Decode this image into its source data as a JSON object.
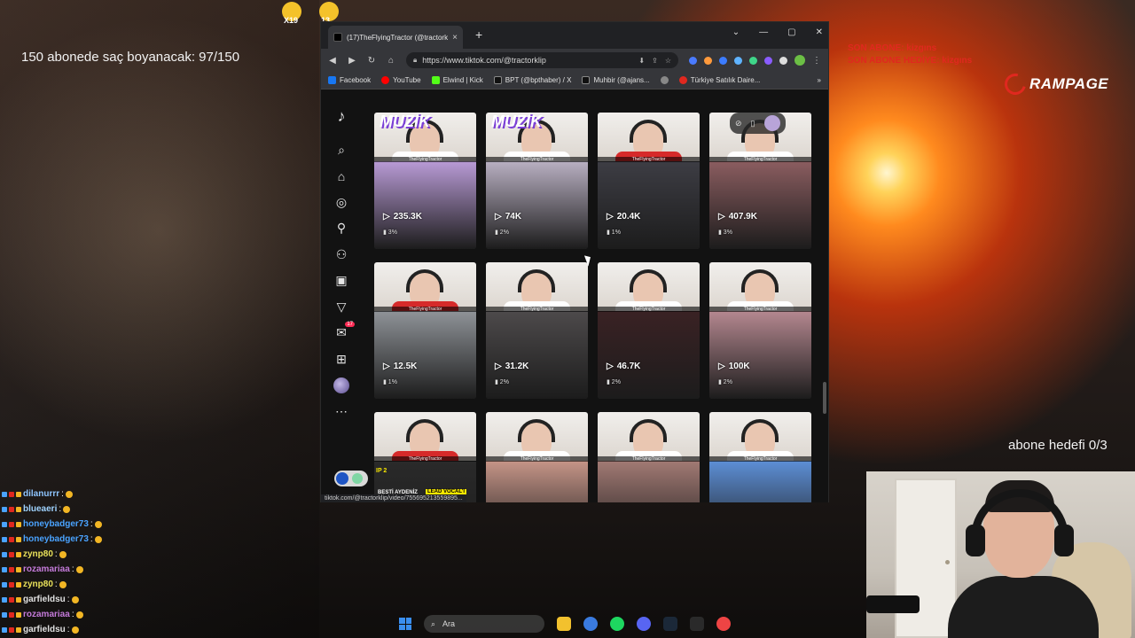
{
  "overlay": {
    "sub_goal": "150 abonede saç boyanacak: 97/150",
    "abone_hedefi": "abone hedefi 0/3",
    "son_abone": "SON ABONE: kizgıns",
    "son_abone_hediye": "SON ABONE HEDİYE: kizgıns",
    "brand": "RAMPAGE",
    "emote_1_count": "X19",
    "emote_2_count": "13"
  },
  "browser": {
    "tab_title": "(17)TheFlyingTractor (@tractorkli",
    "tab_close": "×",
    "new_tab": "+",
    "url": "https://www.tiktok.com/@tractorklip",
    "window_controls": [
      "⌄",
      "—",
      "▢",
      "✕"
    ],
    "bookmarks": [
      {
        "label": "Facebook",
        "color": "#1877f2"
      },
      {
        "label": "YouTube",
        "color": "#ff0000"
      },
      {
        "label": "Elwind | Kick",
        "color": "#53fc18"
      },
      {
        "label": "BPT (@bpthaber) / X",
        "color": "#111111"
      },
      {
        "label": "Muhbir (@ajans...",
        "color": "#111111"
      },
      {
        "label": "",
        "color": "#888888"
      },
      {
        "label": "Türkiye Satılık Daire...",
        "color": "#e0281f"
      }
    ],
    "status_url": "tiktok.com/@tractorklip/video/755695213559895..."
  },
  "tiktok": {
    "notification_count": "17",
    "sidebar_icons": [
      "tiktok-logo-icon",
      "search-icon",
      "home-icon",
      "explore-icon",
      "following-icon",
      "friends-icon",
      "live-icon",
      "upload-icon",
      "inbox-icon",
      "create-icon",
      "profile-icon",
      "more-icon"
    ],
    "videos": [
      {
        "views": "235.3K",
        "pct": "3%",
        "muzik": "MUZİK",
        "shirt": "#ffffff",
        "bottom": "#b99bd6"
      },
      {
        "views": "74K",
        "pct": "2%",
        "muzik": "MUZİK",
        "shirt": "#ffffff",
        "bottom": "#b9b0c2"
      },
      {
        "views": "20.4K",
        "pct": "1%",
        "muzik": "",
        "shirt": "#d62a2a",
        "bottom": "#3d3d44"
      },
      {
        "views": "407.9K",
        "pct": "3%",
        "muzik": "",
        "shirt": "#ffffff",
        "bottom": "#8b5d60"
      },
      {
        "views": "12.5K",
        "pct": "1%",
        "muzik": "",
        "shirt": "#d62a2a",
        "bottom": "#8f9398"
      },
      {
        "views": "31.2K",
        "pct": "2%",
        "muzik": "",
        "shirt": "#ffffff",
        "bottom": "#4d4a4b"
      },
      {
        "views": "46.7K",
        "pct": "2%",
        "muzik": "",
        "shirt": "#ffffff",
        "bottom": "#3a2224"
      },
      {
        "views": "100K",
        "pct": "2%",
        "muzik": "",
        "shirt": "#ffffff",
        "bottom": "#b58890"
      },
      {
        "views": "",
        "pct": "",
        "muzik": "",
        "shirt": "#d62a2a",
        "bottom": "#2a2a2a"
      },
      {
        "views": "",
        "pct": "",
        "muzik": "",
        "shirt": "#ffffff",
        "bottom": "#c69588"
      },
      {
        "views": "",
        "pct": "",
        "muzik": "",
        "shirt": "#ffffff",
        "bottom": "#a27a74"
      },
      {
        "views": "",
        "pct": "",
        "muzik": "",
        "shirt": "#ffffff",
        "bottom": "#5d8fd6"
      }
    ],
    "card_brand": "TheFlyingTractor",
    "row3_label": "BESTİ AYDENİZ",
    "row3_tag": "LEAD VOCAL'I",
    "row3_ip": "IP 2"
  },
  "chat": [
    {
      "user": "dilanurrr",
      "color": "#8ec5ff"
    },
    {
      "user": "blueaeri",
      "color": "#9fd3ff"
    },
    {
      "user": "honeybadger73",
      "color": "#4aa3ff"
    },
    {
      "user": "honeybadger73",
      "color": "#4aa3ff"
    },
    {
      "user": "zynp80",
      "color": "#e8e05a"
    },
    {
      "user": "rozamariaa",
      "color": "#c47ad9"
    },
    {
      "user": "zynp80",
      "color": "#e8e05a"
    },
    {
      "user": "garfieldsu",
      "color": "#e0e0e0"
    },
    {
      "user": "rozamariaa",
      "color": "#c47ad9"
    },
    {
      "user": "garfieldsu",
      "color": "#e0e0e0"
    }
  ],
  "taskbar": {
    "search_label": "Ara"
  }
}
